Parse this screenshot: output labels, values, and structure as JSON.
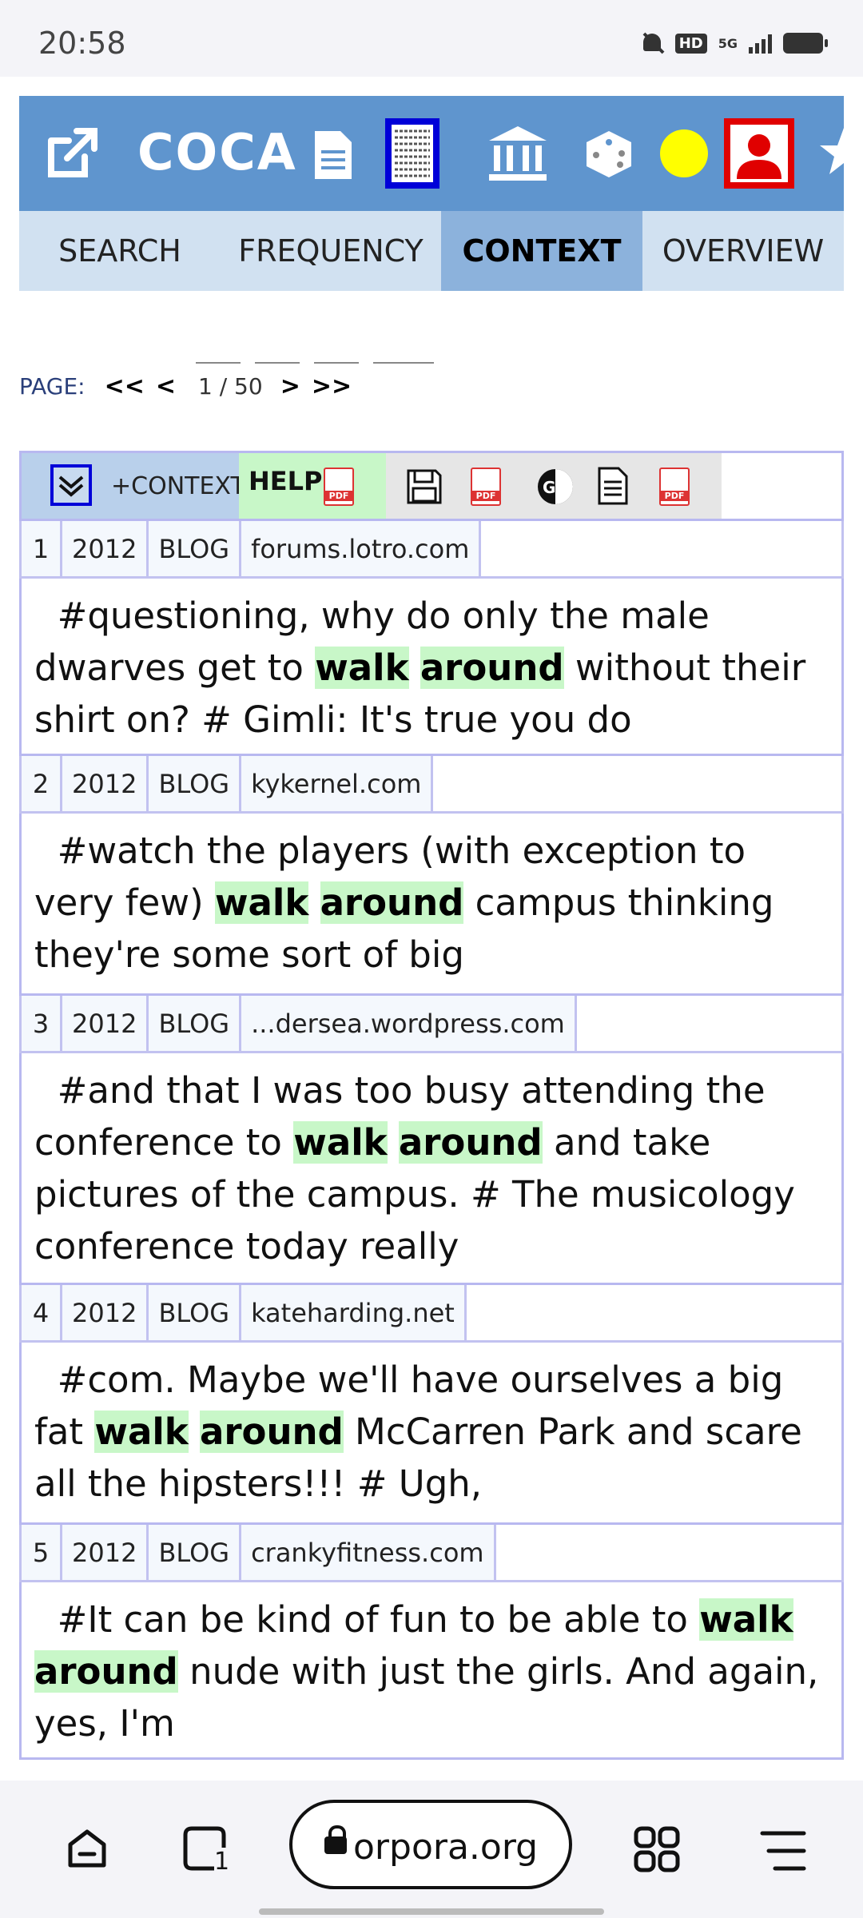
{
  "status": {
    "time": "20:58",
    "hd_badge": "HD",
    "network": "5G"
  },
  "header": {
    "title": "COCA"
  },
  "tabs": [
    {
      "label": "SEARCH",
      "active": false
    },
    {
      "label": "FREQUENCY",
      "active": false
    },
    {
      "label": "CONTEXT",
      "active": true
    },
    {
      "label": "OVERVIEW",
      "active": false
    }
  ],
  "pagination": {
    "label": "PAGE:",
    "first": "<<",
    "prev": "<",
    "current": "1 / 50",
    "next": ">",
    "last": ">>"
  },
  "toolbar": {
    "context_label": "+CONTEXT",
    "help_label": "HELP",
    "pdf_text": "PDF"
  },
  "results": [
    {
      "num": "1",
      "year": "2012",
      "genre": "BLOG",
      "source": "forums.lotro.com",
      "before": "#questioning, why do only the male dwarves get to ",
      "kw1": "walk",
      "kw2": "around",
      "after": " without their shirt on? # Gimli: It's true you do"
    },
    {
      "num": "2",
      "year": "2012",
      "genre": "BLOG",
      "source": "kykernel.com",
      "before": "#watch the players (with exception to very few) ",
      "kw1": "walk",
      "kw2": "around",
      "after": " campus thinking they're some sort of big"
    },
    {
      "num": "3",
      "year": "2012",
      "genre": "BLOG",
      "source": "...dersea.wordpress.com",
      "before": "#and that I was too busy attending the conference to ",
      "kw1": "walk",
      "kw2": "around",
      "after": " and take pictures of the campus. # The musicology conference today really"
    },
    {
      "num": "4",
      "year": "2012",
      "genre": "BLOG",
      "source": "kateharding.net",
      "before": "#com. Maybe we'll have ourselves a big fat ",
      "kw1": "walk",
      "kw2": "around",
      "after": " McCarren Park and scare all the hipsters!!! # Ugh,"
    },
    {
      "num": "5",
      "year": "2012",
      "genre": "BLOG",
      "source": "crankyfitness.com",
      "before": "#It can be kind of fun to be able to ",
      "kw1": "walk",
      "kw2": "around",
      "after": " nude with just the girls. And again, yes, I'm"
    }
  ],
  "browser": {
    "url": "orpora.org",
    "tab_count": "1"
  },
  "colors": {
    "header_bg": "#5f95ce",
    "tab_active": "#8cb2dc",
    "keyword_bg": "#c8f7c8"
  }
}
